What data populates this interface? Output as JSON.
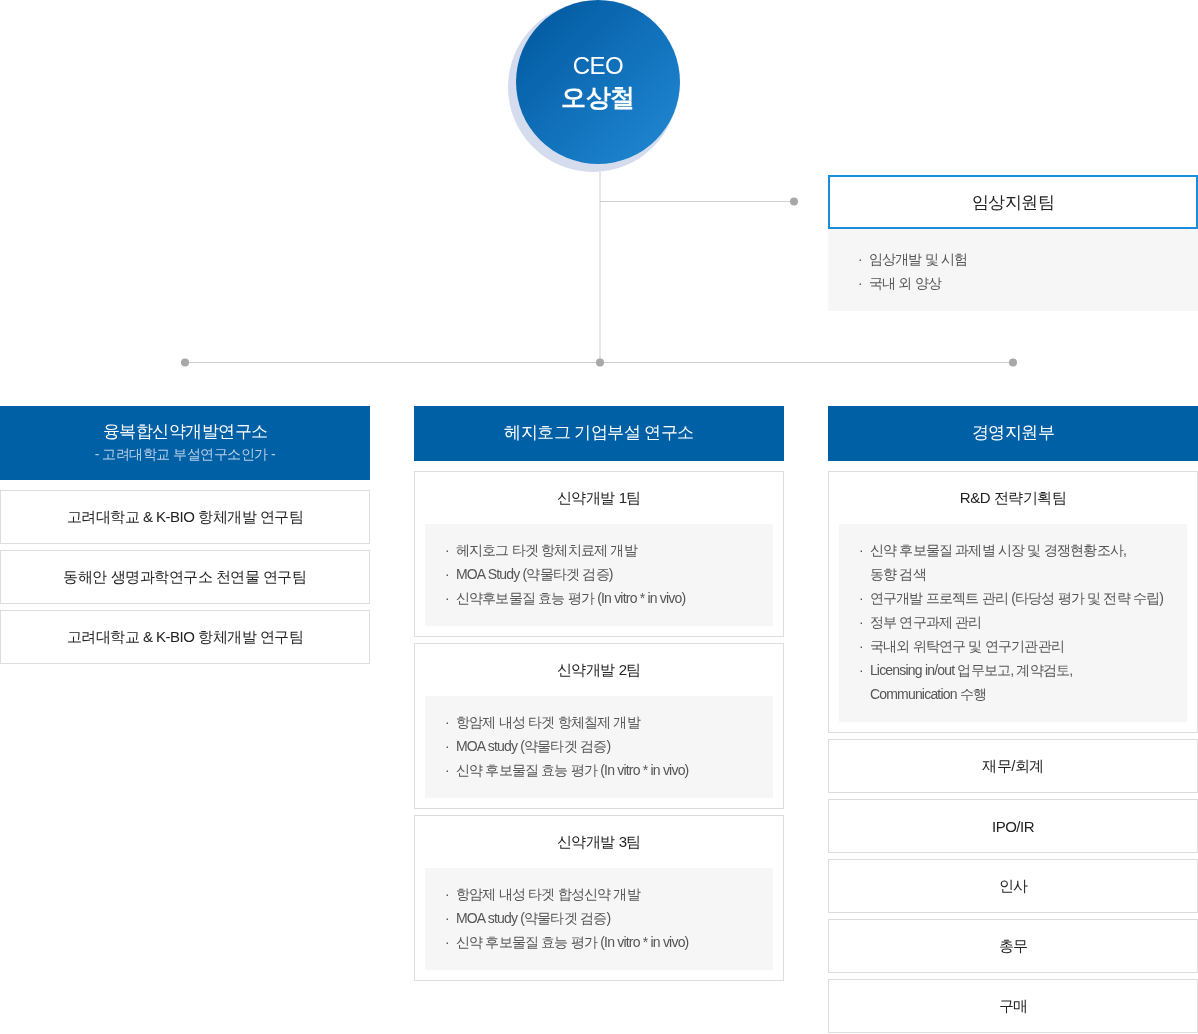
{
  "ceo": {
    "title": "CEO",
    "name": "오상철"
  },
  "clinical_team": {
    "name": "임상지원팀",
    "duties": [
      {
        "bullet": "·",
        "text": "임상개발 및 시험"
      },
      {
        "bullet": "·",
        "text": "국내 외 양상"
      }
    ]
  },
  "divisions": [
    {
      "name": "융복합신약개발연구소",
      "subtitle": "- 고려대학교 부설연구소인가 -",
      "teams": [
        {
          "name": "고려대학교 & K-BIO 항체개발 연구팀"
        },
        {
          "name": "동해안 생명과학연구소 천연물 연구팀"
        },
        {
          "name": "고려대학교 & K-BIO 항체개발 연구팀"
        }
      ]
    },
    {
      "name": "헤지호그 기업부설 연구소",
      "teams": [
        {
          "name": "신약개발 1팀",
          "duties": [
            {
              "bullet": "·",
              "text": "헤지호그 타겟 항체치료제 개발"
            },
            {
              "bullet": "·",
              "text": "MOA Study (약물타겟 검증)"
            },
            {
              "bullet": "·",
              "text": "신약후보물질 효능 평가 (In vitro * in vivo)"
            }
          ]
        },
        {
          "name": "신약개발 2팀",
          "duties": [
            {
              "bullet": "·",
              "text": "항암제 내성 타겟 항체칠제 개발"
            },
            {
              "bullet": "·",
              "text": "MOA study (약물타겟 검증)"
            },
            {
              "bullet": "·",
              "text": "신약 후보물질 효능 평가 (In vitro * in vivo)"
            }
          ]
        },
        {
          "name": "신약개발 3팀",
          "duties": [
            {
              "bullet": "·",
              "text": "항암제 내성 타겟 합성신약 개발"
            },
            {
              "bullet": "·",
              "text": "MOA study (약물타겟 검증)"
            },
            {
              "bullet": "·",
              "text": "신약 후보물질 효능 평가 (In vitro * in vivo)"
            }
          ]
        }
      ]
    },
    {
      "name": "경영지원부",
      "teams": [
        {
          "name": "R&D 전략기획팀",
          "duties": [
            {
              "bullet": "·",
              "text": "신약 후보물질 과제별 시장 및 경쟁현황조사,\n동향 검색"
            },
            {
              "bullet": "·",
              "text": "연구개발 프로젝트 관리 (타당성 평가 및 전략 수립)"
            },
            {
              "bullet": "·",
              "text": "정부 연구과제 관리"
            },
            {
              "bullet": "·",
              "text": "국내외 위탁연구 및 연구기관관리"
            },
            {
              "bullet": "·",
              "text": "Licensing in/out 업무보고, 계약검토,\nCommunication 수행"
            }
          ]
        },
        {
          "name": "재무/회계"
        },
        {
          "name": "IPO/IR"
        },
        {
          "name": "인사"
        },
        {
          "name": "총무"
        },
        {
          "name": "구매"
        }
      ]
    }
  ]
}
